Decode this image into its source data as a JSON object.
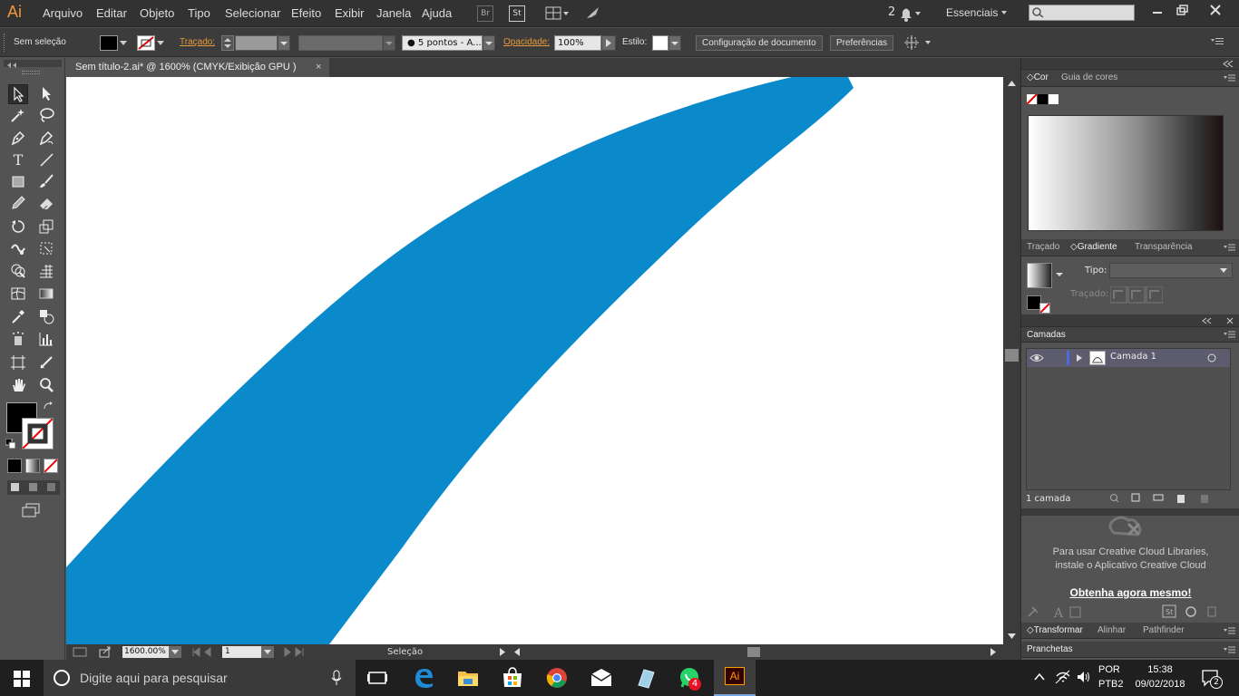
{
  "app": {
    "logo": "Ai",
    "menu": [
      "Arquivo",
      "Editar",
      "Objeto",
      "Tipo",
      "Selecionar",
      "Efeito",
      "Exibir",
      "Janela",
      "Ajuda"
    ],
    "header_buttons": {
      "br": "Br",
      "st": "St"
    },
    "notifications": "2",
    "workspace": "Essenciais",
    "search_placeholder": ""
  },
  "control_bar": {
    "selection": "Sem seleção",
    "stroke_label": "Traçado:",
    "brush": "5 pontos - A...",
    "opacity_label": "Opacidade:",
    "opacity": "100%",
    "style_label": "Estilo:",
    "doc_setup": "Configuração de documento",
    "prefs": "Preferências"
  },
  "document": {
    "tab": "Sem título-2.ai* @ 1600% (CMYK/Exibição GPU )",
    "close": "×",
    "zoom": "1600.00%",
    "artboard": "1",
    "status": "Seleção",
    "shape_color": "#0a89cb"
  },
  "panels": {
    "color_tabs": [
      "Cor",
      "Guia de cores"
    ],
    "grad_tabs": [
      "Traçado",
      "Gradiente",
      "Transparência"
    ],
    "tipo_label": "Tipo:",
    "tracado_label": "Traçado:",
    "layers_title": "Camadas",
    "layer_name": "Camada 1",
    "layer_count": "1 camada",
    "cc_line1": "Para usar Creative Cloud Libraries,",
    "cc_line2": "instale o Aplicativo Creative Cloud",
    "cc_link": "Obtenha agora mesmo!",
    "bottom_tabs": [
      "Transformar",
      "Alinhar",
      "Pathfinder"
    ],
    "pranchetas": "Pranchetas"
  },
  "taskbar": {
    "search": "Digite aqui para pesquisar",
    "lang1": "POR",
    "lang2": "PTB2",
    "time": "15:38",
    "date": "09/02/2018",
    "whatsapp_badge": "4",
    "notif_count": "2",
    "ai_label": "Ai"
  }
}
